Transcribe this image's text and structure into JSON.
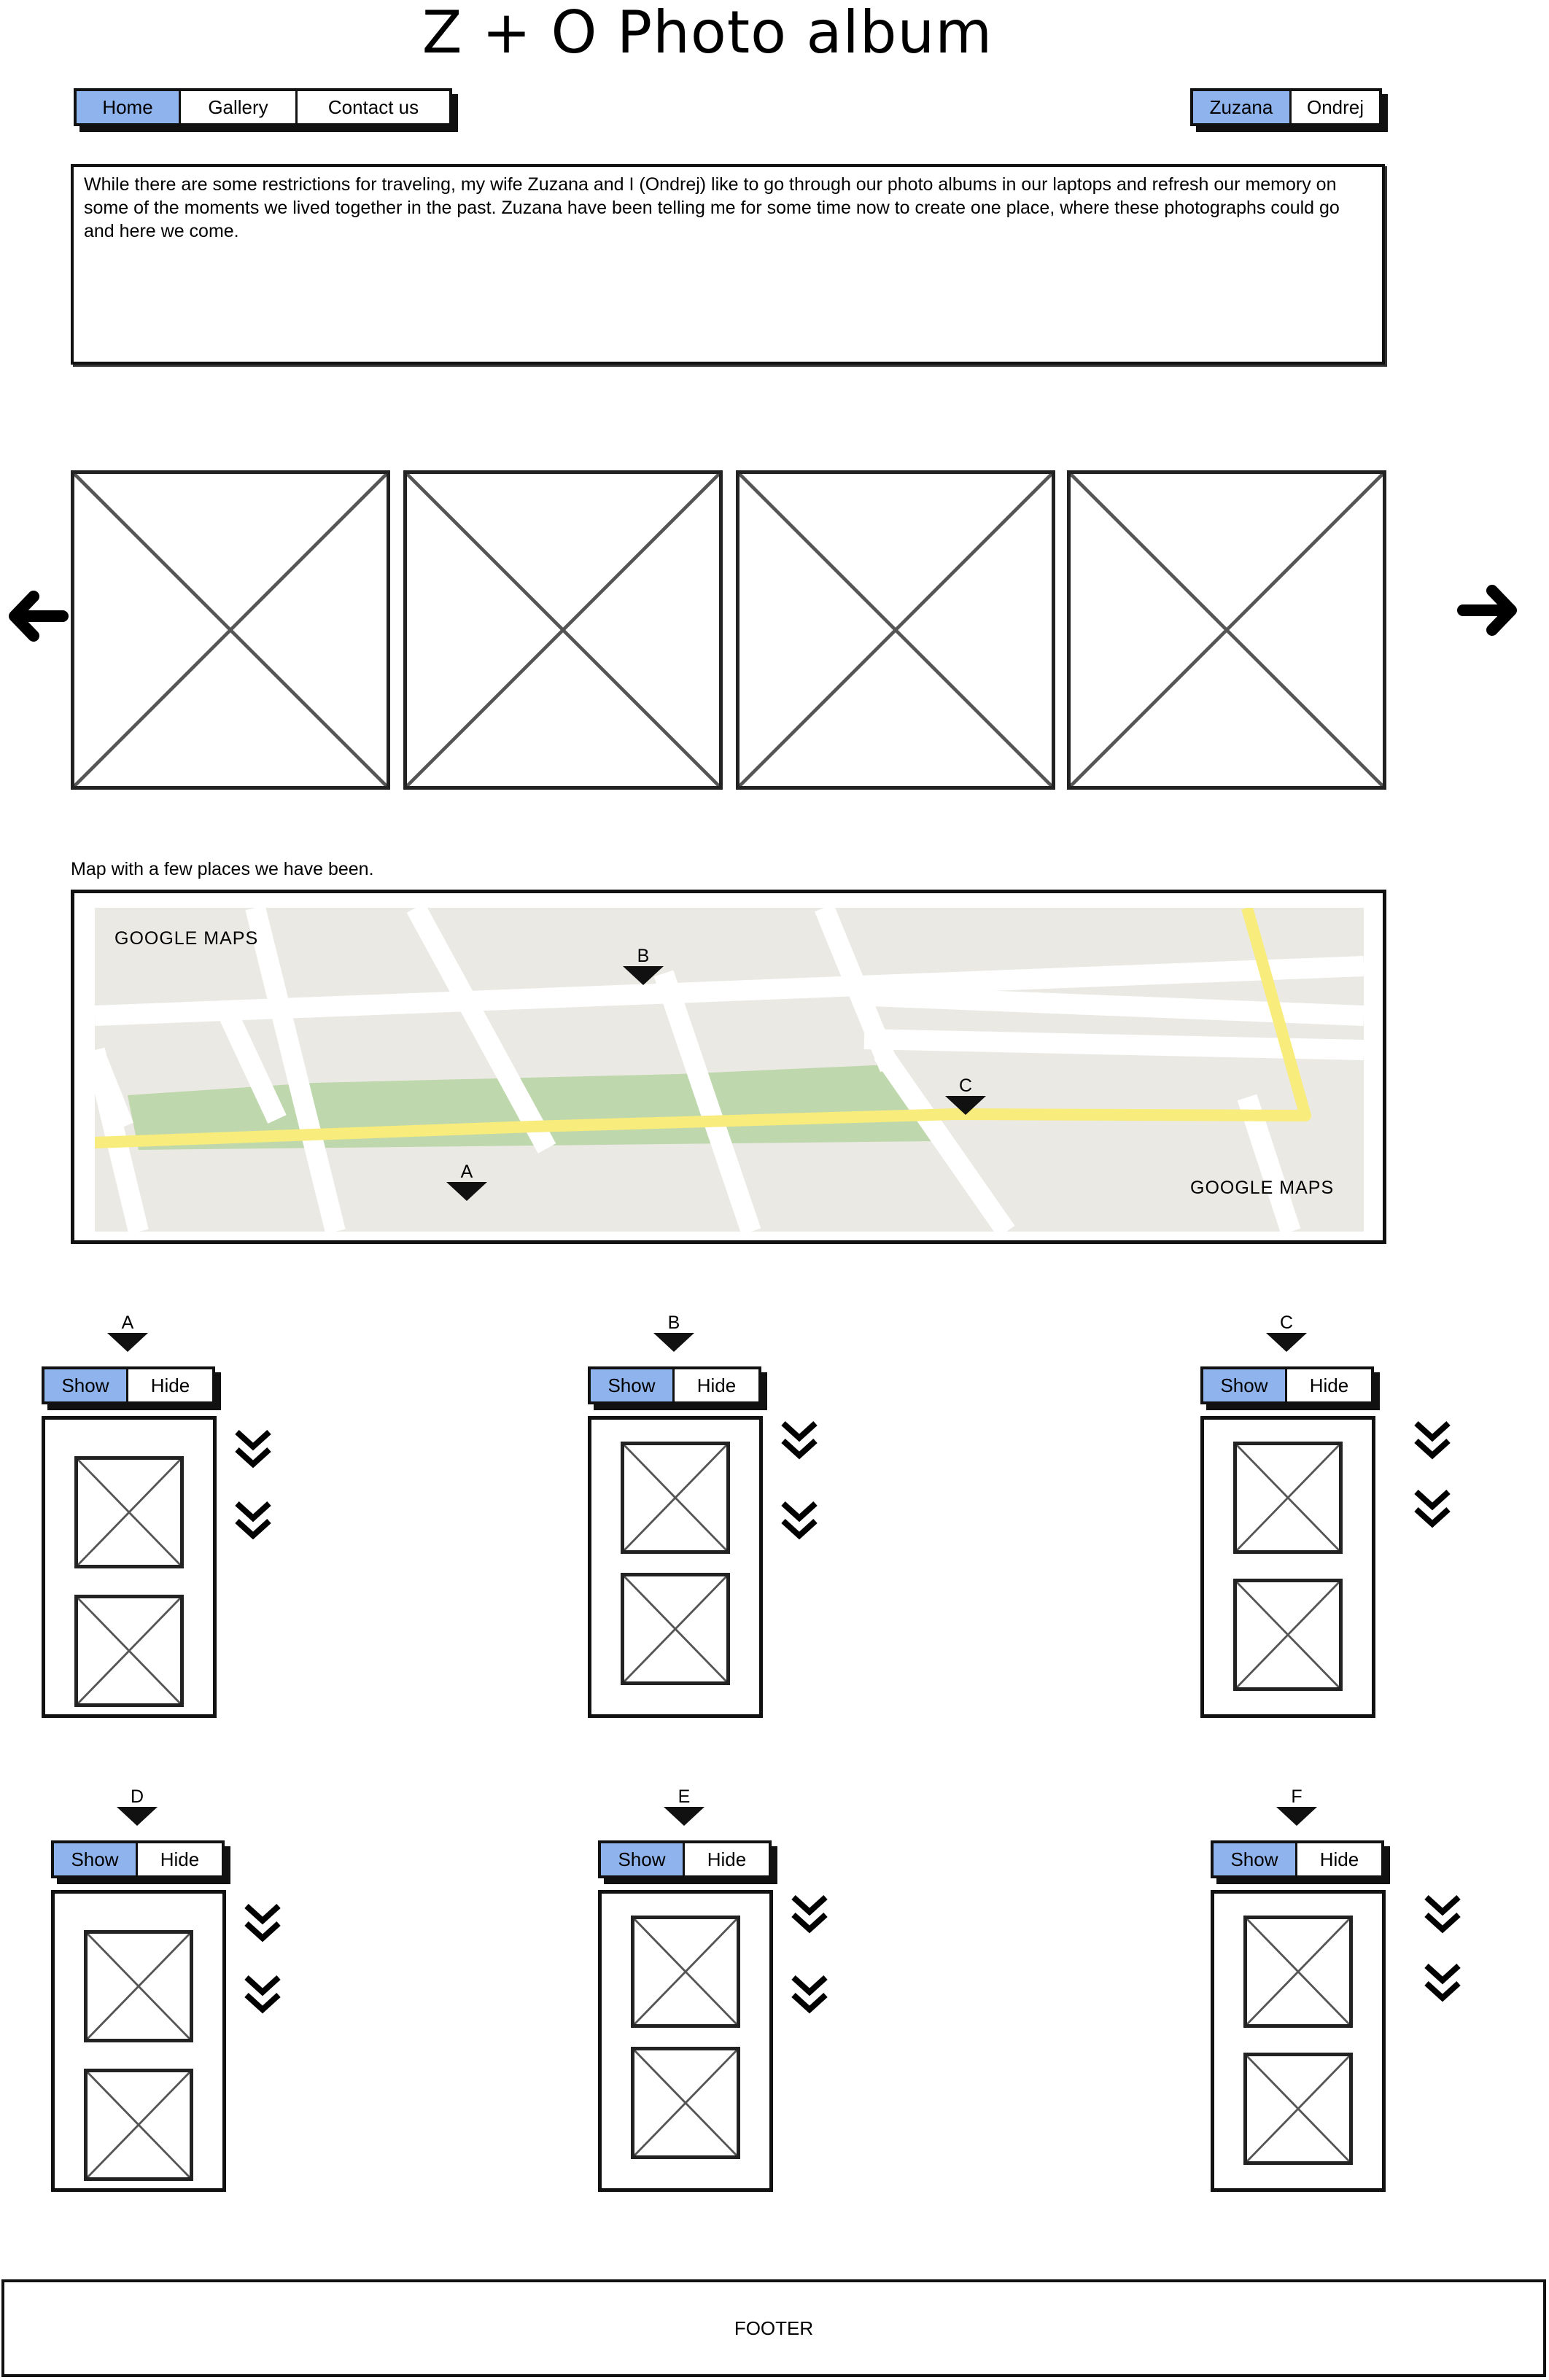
{
  "header": {
    "title": "Z + O  Photo album"
  },
  "nav": {
    "items": [
      {
        "label": "Home",
        "active": true
      },
      {
        "label": "Gallery",
        "active": false
      },
      {
        "label": "Contact us",
        "active": false
      }
    ]
  },
  "user_switch": {
    "items": [
      {
        "label": "Zuzana",
        "active": true
      },
      {
        "label": "Ondrej",
        "active": false
      }
    ]
  },
  "intro": {
    "text": "While there are some restrictions for traveling, my wife Zuzana and I (Ondrej) like to go through our photo albums in our laptops and refresh our memory on some of the moments we lived together in the past. Zuzana have been telling me for some time now to create one place, where these photographs could go and here we come."
  },
  "carousel": {
    "prev_icon": "arrow-left-icon",
    "next_icon": "arrow-right-icon",
    "image_count": 4
  },
  "map": {
    "caption": "Map with a few places we have been.",
    "label_top": "GOOGLE MAPS",
    "label_bottom": "GOOGLE MAPS",
    "markers": [
      "B",
      "C",
      "A"
    ]
  },
  "places": [
    {
      "label": "A",
      "show": "Show",
      "hide": "Hide"
    },
    {
      "label": "B",
      "show": "Show",
      "hide": "Hide"
    },
    {
      "label": "C",
      "show": "Show",
      "hide": "Hide"
    },
    {
      "label": "D",
      "show": "Show",
      "hide": "Hide"
    },
    {
      "label": "E",
      "show": "Show",
      "hide": "Hide"
    },
    {
      "label": "F",
      "show": "Show",
      "hide": "Hide"
    }
  ],
  "footer": {
    "text": "FOOTER"
  },
  "colors": {
    "active_button": "#8fb3ec",
    "map_bg": "#ebe9e3",
    "map_road": "#ffffff",
    "map_highway": "#f7ec7c",
    "map_park": "#bfd7ac"
  }
}
